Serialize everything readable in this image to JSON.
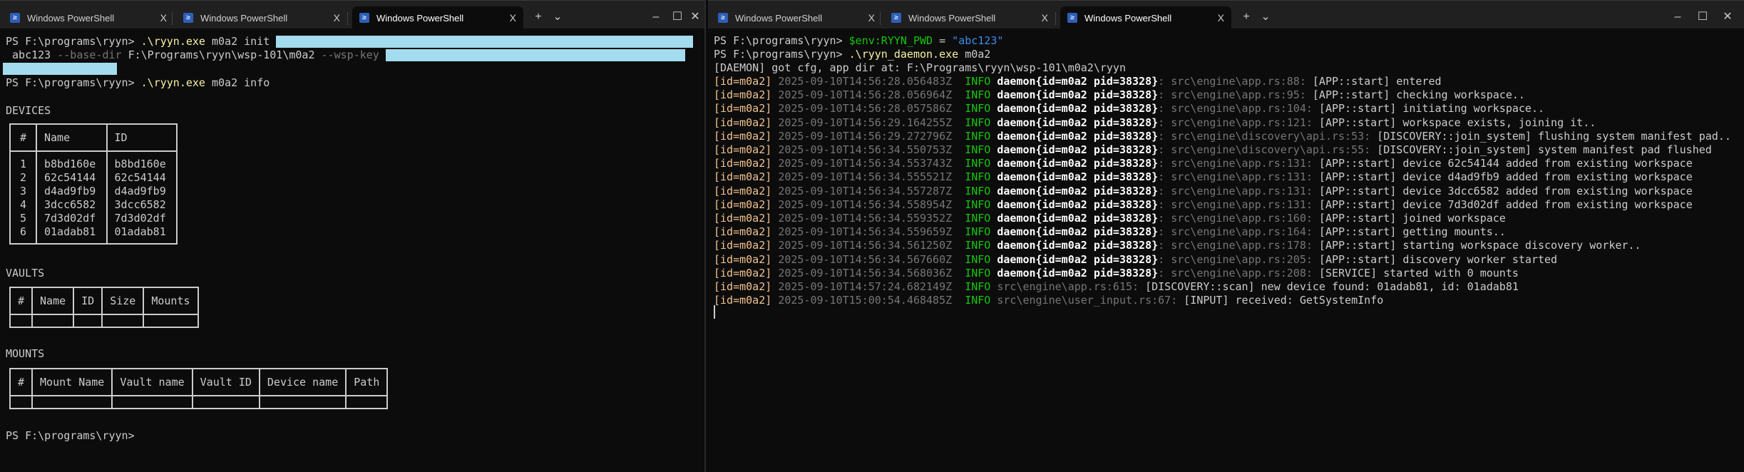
{
  "left": {
    "tabs": [
      {
        "label": "Windows PowerShell"
      },
      {
        "label": "Windows PowerShell"
      },
      {
        "label": "Windows PowerShell",
        "active": true
      }
    ],
    "prompt": "PS F:\\programs\\ryyn> ",
    "cmd1": {
      "exe": ".\\ryyn.exe",
      "args": " m0a2 init ",
      "line2a": " abc123 ",
      "opt1": "--base-dir",
      "line2b": " F:\\Programs\\ryyn\\wsp-101\\m0a2 ",
      "opt2": "--wsp-key"
    },
    "cmd2": {
      "exe": ".\\ryyn.exe",
      "args": " m0a2 info"
    },
    "devices": {
      "title": "DEVICES",
      "headers": [
        "#",
        "Name",
        "ID"
      ],
      "rows": [
        [
          "1",
          "b8bd160e",
          "b8bd160e"
        ],
        [
          "2",
          "62c54144",
          "62c54144"
        ],
        [
          "3",
          "d4ad9fb9",
          "d4ad9fb9"
        ],
        [
          "4",
          "3dcc6582",
          "3dcc6582"
        ],
        [
          "5",
          "7d3d02df",
          "7d3d02df"
        ],
        [
          "6",
          "01adab81",
          "01adab81"
        ]
      ]
    },
    "vaults": {
      "title": "VAULTS",
      "headers": [
        "#",
        "Name",
        "ID",
        "Size",
        "Mounts"
      ]
    },
    "mounts": {
      "title": "MOUNTS",
      "headers": [
        "#",
        "Mount Name",
        "Vault name",
        "Vault ID",
        "Device name",
        "Path"
      ]
    },
    "final_prompt": "PS F:\\programs\\ryyn>"
  },
  "right": {
    "tabs": [
      {
        "label": "Windows PowerShell"
      },
      {
        "label": "Windows PowerShell"
      },
      {
        "label": "Windows PowerShell",
        "active": true
      }
    ],
    "prompt": "PS F:\\programs\\ryyn> ",
    "cmd1": {
      "var": "$env:RYYN_PWD",
      "op": " = ",
      "str": "\"abc123\""
    },
    "cmd2": {
      "exe": ".\\ryyn_daemon.exe",
      "args": " m0a2"
    },
    "daemon_line": "[DAEMON] got cfg, app dir at: F:\\Programs\\ryyn\\wsp-101\\m0a2\\ryyn",
    "logs": [
      {
        "id": "[id=m0a2]",
        "ts": "2025-09-10T14:56:28.056483Z",
        "lvl": "INFO",
        "span": "daemon{id=m0a2 pid=38328}",
        "src": ": src\\engine\\app.rs:88:",
        "msg": " [APP::start] entered"
      },
      {
        "id": "[id=m0a2]",
        "ts": "2025-09-10T14:56:28.056964Z",
        "lvl": "INFO",
        "span": "daemon{id=m0a2 pid=38328}",
        "src": ": src\\engine\\app.rs:95:",
        "msg": " [APP::start] checking workspace.."
      },
      {
        "id": "[id=m0a2]",
        "ts": "2025-09-10T14:56:28.057586Z",
        "lvl": "INFO",
        "span": "daemon{id=m0a2 pid=38328}",
        "src": ": src\\engine\\app.rs:104:",
        "msg": " [APP::start] initiating workspace.."
      },
      {
        "id": "[id=m0a2]",
        "ts": "2025-09-10T14:56:29.164255Z",
        "lvl": "INFO",
        "span": "daemon{id=m0a2 pid=38328}",
        "src": ": src\\engine\\app.rs:121:",
        "msg": " [APP::start] workspace exists, joining it.."
      },
      {
        "id": "[id=m0a2]",
        "ts": "2025-09-10T14:56:29.272796Z",
        "lvl": "INFO",
        "span": "daemon{id=m0a2 pid=38328}",
        "src": ": src\\engine\\discovery\\api.rs:53:",
        "msg": " [DISCOVERY::join_system] flushing system manifest pad.."
      },
      {
        "id": "[id=m0a2]",
        "ts": "2025-09-10T14:56:34.550753Z",
        "lvl": "INFO",
        "span": "daemon{id=m0a2 pid=38328}",
        "src": ": src\\engine\\discovery\\api.rs:55:",
        "msg": " [DISCOVERY::join_system] system manifest pad flushed"
      },
      {
        "id": "[id=m0a2]",
        "ts": "2025-09-10T14:56:34.553743Z",
        "lvl": "INFO",
        "span": "daemon{id=m0a2 pid=38328}",
        "src": ": src\\engine\\app.rs:131:",
        "msg": " [APP::start] device 62c54144 added from existing workspace"
      },
      {
        "id": "[id=m0a2]",
        "ts": "2025-09-10T14:56:34.555521Z",
        "lvl": "INFO",
        "span": "daemon{id=m0a2 pid=38328}",
        "src": ": src\\engine\\app.rs:131:",
        "msg": " [APP::start] device d4ad9fb9 added from existing workspace"
      },
      {
        "id": "[id=m0a2]",
        "ts": "2025-09-10T14:56:34.557287Z",
        "lvl": "INFO",
        "span": "daemon{id=m0a2 pid=38328}",
        "src": ": src\\engine\\app.rs:131:",
        "msg": " [APP::start] device 3dcc6582 added from existing workspace"
      },
      {
        "id": "[id=m0a2]",
        "ts": "2025-09-10T14:56:34.558954Z",
        "lvl": "INFO",
        "span": "daemon{id=m0a2 pid=38328}",
        "src": ": src\\engine\\app.rs:131:",
        "msg": " [APP::start] device 7d3d02df added from existing workspace"
      },
      {
        "id": "[id=m0a2]",
        "ts": "2025-09-10T14:56:34.559352Z",
        "lvl": "INFO",
        "span": "daemon{id=m0a2 pid=38328}",
        "src": ": src\\engine\\app.rs:160:",
        "msg": " [APP::start] joined workspace"
      },
      {
        "id": "[id=m0a2]",
        "ts": "2025-09-10T14:56:34.559659Z",
        "lvl": "INFO",
        "span": "daemon{id=m0a2 pid=38328}",
        "src": ": src\\engine\\app.rs:164:",
        "msg": " [APP::start] getting mounts.."
      },
      {
        "id": "[id=m0a2]",
        "ts": "2025-09-10T14:56:34.561250Z",
        "lvl": "INFO",
        "span": "daemon{id=m0a2 pid=38328}",
        "src": ": src\\engine\\app.rs:178:",
        "msg": " [APP::start] starting workspace discovery worker.."
      },
      {
        "id": "[id=m0a2]",
        "ts": "2025-09-10T14:56:34.567660Z",
        "lvl": "INFO",
        "span": "daemon{id=m0a2 pid=38328}",
        "src": ": src\\engine\\app.rs:205:",
        "msg": " [APP::start] discovery worker started"
      },
      {
        "id": "[id=m0a2]",
        "ts": "2025-09-10T14:56:34.568036Z",
        "lvl": "INFO",
        "span": "daemon{id=m0a2 pid=38328}",
        "src": ": src\\engine\\app.rs:208:",
        "msg": " [SERVICE] started with 0 mounts"
      },
      {
        "id": "[id=m0a2]",
        "ts": "2025-09-10T14:57:24.682149Z",
        "lvl": "INFO",
        "span": "",
        "src": "src\\engine\\app.rs:615:",
        "msg": " [DISCOVERY::scan] new device found: 01adab81, id: 01adab81"
      },
      {
        "id": "[id=m0a2]",
        "ts": "2025-09-10T15:00:54.468485Z",
        "lvl": "INFO",
        "span": "",
        "src": "src\\engine\\user_input.rs:67:",
        "msg": " [INPUT] received: GetSystemInfo"
      }
    ]
  },
  "window_controls": {
    "new_tab": "+",
    "dropdown": "⌄",
    "minimize": "–",
    "maximize": "☐",
    "close": "✕",
    "tab_close": "X",
    "ps_icon": "≥"
  },
  "colors": {
    "background": "#0c0c0c",
    "tabbar": "#202020",
    "exe": "#f9f1a5",
    "info": "#16c60c",
    "id_tag": "#f2c38f",
    "redaction": "#a3dcee"
  }
}
